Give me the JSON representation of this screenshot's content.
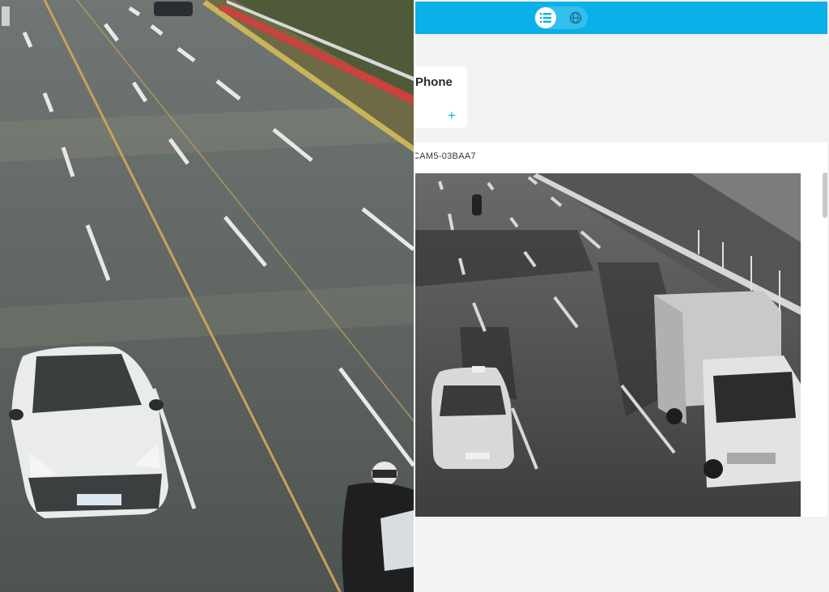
{
  "app": {
    "view_toggle": {
      "list_icon": "list-icon",
      "globe_icon": "globe-icon",
      "active": "list"
    },
    "device_card": {
      "title": "Phone",
      "add_symbol": "+"
    },
    "camera": {
      "label": "CAM5-03BAA7"
    },
    "colors": {
      "topbar": "#0ab0e8",
      "accent": "#0ab0e8",
      "background": "#f2f2f2"
    }
  }
}
